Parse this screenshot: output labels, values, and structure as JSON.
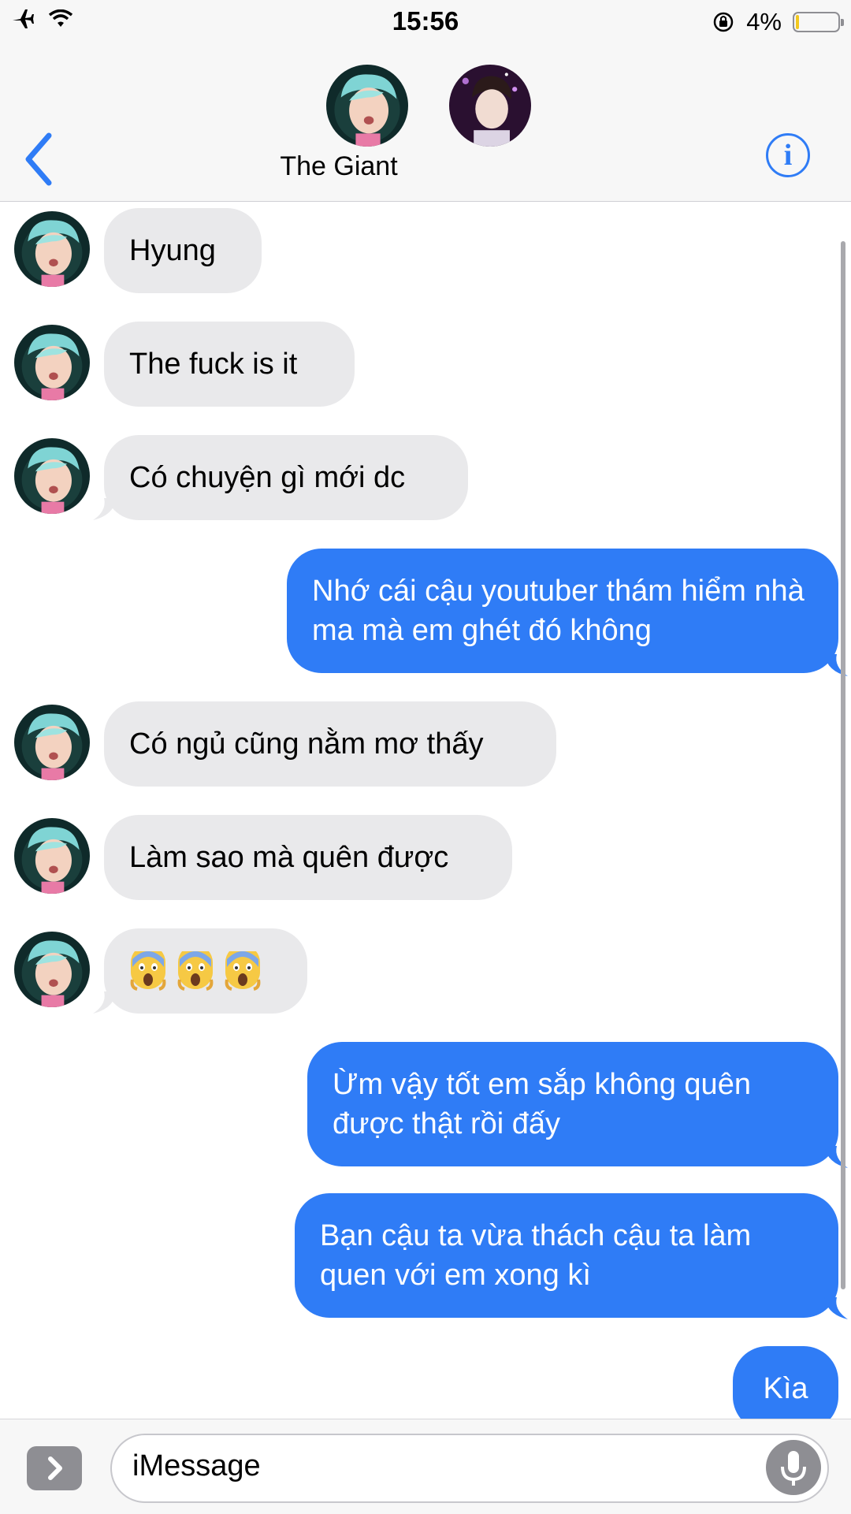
{
  "status_bar": {
    "time": "15:56",
    "battery": "4%",
    "battery_level": 0.04
  },
  "header": {
    "contact_name": "The Giant",
    "info_label": "i"
  },
  "messages": [
    {
      "dir": "in",
      "text": "Hyung"
    },
    {
      "dir": "in",
      "text": "The fuck is it"
    },
    {
      "dir": "in",
      "text": "Có chuyện gì mới dc"
    },
    {
      "dir": "out",
      "text": "Nhớ cái cậu youtuber thám hiểm nhà ma mà em ghét đó không"
    },
    {
      "dir": "in",
      "text": "Có ngủ cũng nằm mơ thấy"
    },
    {
      "dir": "in",
      "text": "Làm sao mà quên được"
    },
    {
      "dir": "in",
      "emoji": "screaming-face",
      "count": 3
    },
    {
      "dir": "out",
      "text": "Ừm vậy tốt em sắp không quên được thật rồi đấy"
    },
    {
      "dir": "out",
      "text": "Bạn cậu ta vừa thách cậu ta làm quen với em xong kì"
    },
    {
      "dir": "out",
      "text": "Kìa"
    }
  ],
  "input": {
    "placeholder": "iMessage"
  },
  "icons": {
    "airplane": "airplane-icon",
    "wifi": "wifi-icon",
    "rotation_lock": "rotation-lock-icon",
    "back": "chevron-left-icon",
    "apps": "chevron-right-icon",
    "mic": "microphone-icon"
  },
  "colors": {
    "accent": "#2f7cf6",
    "incoming_bubble": "#e9e9eb",
    "bar": "#f7f7f7"
  }
}
